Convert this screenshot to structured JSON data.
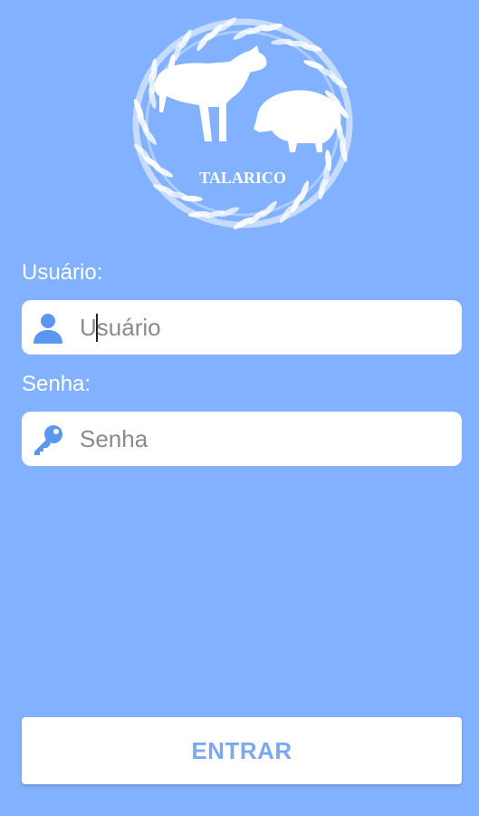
{
  "brand": {
    "logo_text": "TALARICO"
  },
  "form": {
    "user_label": "Usuário:",
    "user_placeholder": "Usuário",
    "user_value": "",
    "user_icon": "user-icon",
    "pass_label": "Senha:",
    "pass_placeholder": "Senha",
    "pass_value": "",
    "pass_icon": "key-icon",
    "submit_label": "ENTRAR"
  },
  "colors": {
    "background": "#82b1ff",
    "icon": "#5b97f0",
    "button_text": "#7ba8f5"
  }
}
